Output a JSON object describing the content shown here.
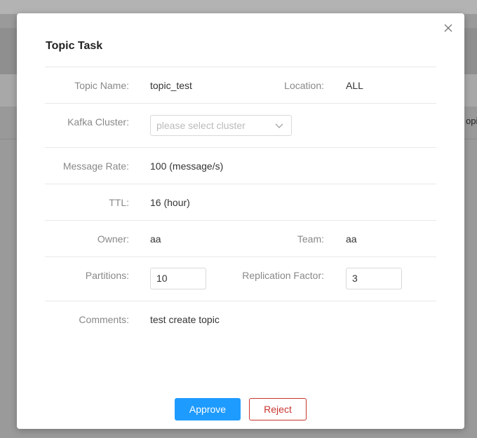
{
  "background": {
    "peek_text": "opi"
  },
  "modal": {
    "title": "Topic Task",
    "fields": {
      "topic_name": {
        "label": "Topic Name:",
        "value": "topic_test"
      },
      "location": {
        "label": "Location:",
        "value": "ALL"
      },
      "kafka_cluster": {
        "label": "Kafka Cluster:",
        "placeholder": "please select cluster"
      },
      "message_rate": {
        "label": "Message Rate:",
        "value": "100 (message/s)"
      },
      "ttl": {
        "label": "TTL:",
        "value": "16 (hour)"
      },
      "owner": {
        "label": "Owner:",
        "value": "aa"
      },
      "team": {
        "label": "Team:",
        "value": "aa"
      },
      "partitions": {
        "label": "Partitions:",
        "value": "10"
      },
      "replication_factor": {
        "label": "Replication Factor:",
        "value": "3"
      },
      "comments": {
        "label": "Comments:",
        "value": "test create topic"
      }
    },
    "buttons": {
      "approve": "Approve",
      "reject": "Reject"
    }
  },
  "colors": {
    "primary": "#1e9bff",
    "danger": "#c8352f"
  }
}
